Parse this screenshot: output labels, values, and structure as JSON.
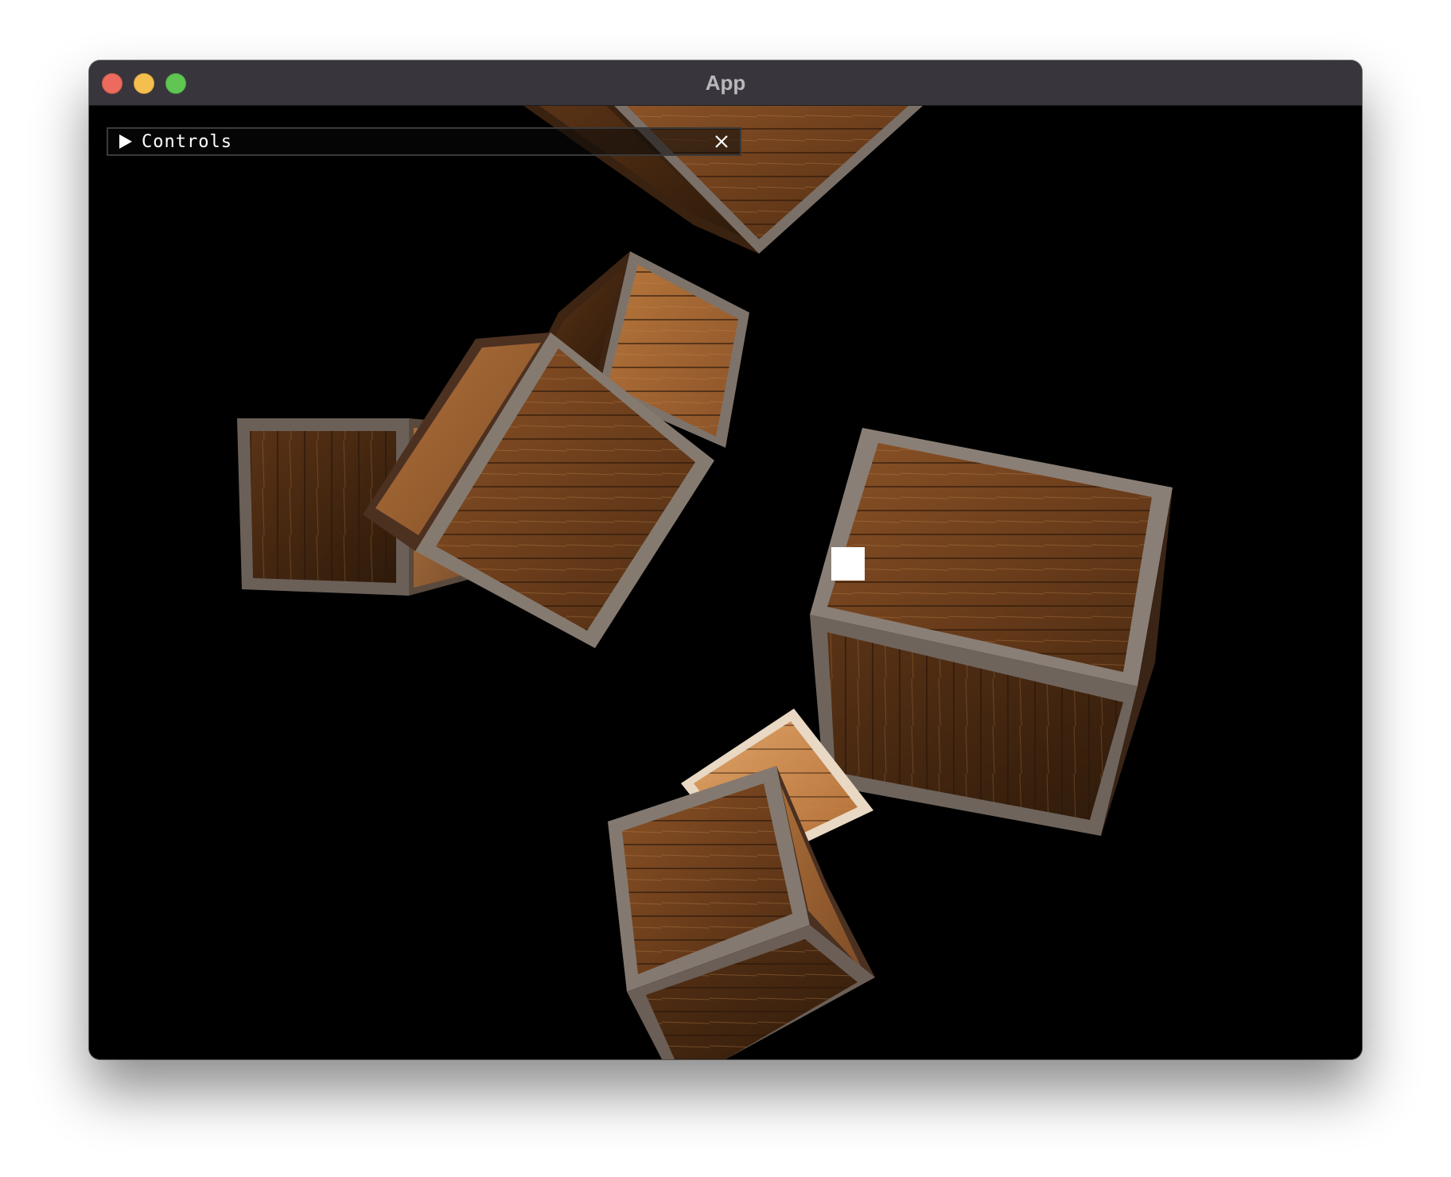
{
  "window": {
    "title": "App"
  },
  "controls": {
    "label": "Controls",
    "collapsed": true
  },
  "icons": {
    "expand": "triangle-right-icon",
    "close": "close-icon"
  },
  "colors": {
    "titlebar": "#38363c",
    "viewport_background": "#000000",
    "traffic_close": "#ed6a5e",
    "traffic_minimize": "#f5bf4f",
    "traffic_maximize": "#61c554",
    "light_marker": "#ffffff"
  },
  "scene": {
    "object": "wooden-crate",
    "count": 7
  }
}
